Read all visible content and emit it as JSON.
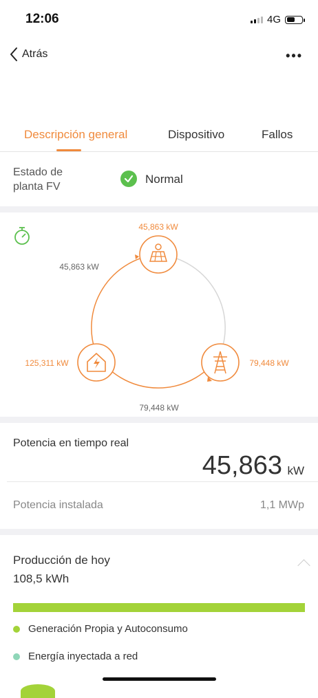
{
  "status_bar": {
    "time": "12:06",
    "network": "4G"
  },
  "nav": {
    "back_label": "Atrás",
    "more_icon": "more-horizontal-icon"
  },
  "tabs": [
    {
      "label": "Descripción general",
      "active": true
    },
    {
      "label": "Dispositivo",
      "active": false
    },
    {
      "label": "Fallos",
      "active": false
    }
  ],
  "plant_state": {
    "label_line1": "Estado de",
    "label_line2": "planta FV",
    "value": "Normal"
  },
  "flow": {
    "pv_power": "45,863 kW",
    "pv_to_home": "45,863 kW",
    "home_power": "125,311 kW",
    "grid_power": "79,448 kW",
    "grid_to_home": "79,448 kW"
  },
  "realtime": {
    "title": "Potencia en tiempo real",
    "value": "45,863",
    "unit": "kW"
  },
  "installed": {
    "label": "Potencia instalada",
    "value": "1,1 MWp"
  },
  "production": {
    "title": "Producción de hoy",
    "value": "108,5  kWh",
    "legend": [
      {
        "label": "Generación Propia y Autoconsumo",
        "color": "#a3d339"
      },
      {
        "label": "Energía inyectada a red",
        "color": "#8fd6b8"
      }
    ]
  },
  "colors": {
    "accent": "#f08a3c",
    "ok": "#5cc04e",
    "self_consumption": "#a3d339"
  }
}
